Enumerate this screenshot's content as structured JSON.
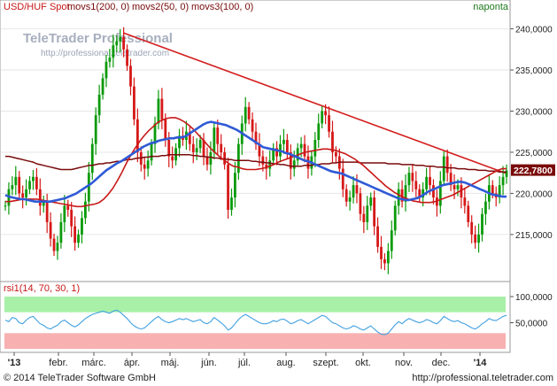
{
  "header": {
    "title": "USD/HUF Spot",
    "indicator_1": "movs1(200, 0)",
    "indicator_2": "movs2(50, 0)",
    "indicator_3": "movs3(100, 0)",
    "period_label": "naponta"
  },
  "watermark": {
    "brand": "TeleTrader Professional",
    "url": "http://professional.teletrader.com"
  },
  "rsi": {
    "label": "rsi1(14, 70, 30, 1)",
    "levels": [
      100,
      70,
      50,
      30,
      0
    ],
    "y_tick_labels": [
      "100,0000",
      "50,0000"
    ]
  },
  "footer": {
    "copyright": "© 2014 TeleTrader Software GmbH",
    "url": "http://professional.teletrader.com"
  },
  "colors": {
    "price_up": "#0a9a0a",
    "price_down": "#d61818",
    "ma200": "#7a0a0a",
    "ma50": "#2f5ad6",
    "ma100": "#c81818",
    "trendline": "#d42020",
    "rsi_line": "#3fa0e0",
    "rsi_overbought_zone": "#a8f0a8",
    "rsi_oversold_zone": "#f8b0b0",
    "last_price_box": "#7a0a0a"
  },
  "chart_data": [
    {
      "type": "line",
      "title": "USD/HUF Spot",
      "x_tick_labels": [
        "'13",
        "febr.",
        "márc.",
        "ápr.",
        "máj.",
        "jún.",
        "júl.",
        "aug.",
        "szept.",
        "okt.",
        "nov.",
        "dec.",
        "'14"
      ],
      "y_tick_labels": [
        "240,0000",
        "235,0000",
        "230,0000",
        "225,0000",
        "220,0000",
        "215,0000"
      ],
      "ylim": [
        209.5,
        242
      ],
      "last_value_label": "222,7800",
      "series": [
        {
          "name": "USD/HUF Spot",
          "style": "ohlc",
          "values": [
            218.5,
            220.5,
            221.0,
            222.0,
            220.0,
            219.5,
            220.5,
            221.5,
            222.0,
            220.5,
            218.5,
            219.0,
            216.5,
            214.5,
            213.0,
            214.0,
            216.5,
            218.5,
            218.0,
            216.0,
            214.0,
            215.0,
            217.0,
            219.0,
            222.5,
            226.0,
            229.5,
            232.0,
            234.0,
            236.0,
            236.5,
            238.0,
            238.5,
            239.0,
            237.5,
            235.5,
            233.0,
            229.0,
            225.0,
            223.5,
            223.0,
            224.0,
            226.0,
            228.5,
            231.5,
            229.0,
            226.5,
            224.5,
            224.0,
            225.5,
            227.0,
            226.5,
            227.5,
            226.0,
            225.0,
            225.5,
            226.5,
            224.5,
            223.5,
            225.0,
            228.0,
            226.0,
            225.0,
            223.5,
            218.0,
            219.5,
            222.5,
            226.0,
            228.5,
            230.5,
            229.0,
            227.5,
            226.0,
            224.5,
            223.5,
            223.0,
            224.0,
            225.5,
            224.5,
            226.0,
            226.5,
            225.0,
            223.0,
            224.0,
            225.5,
            226.0,
            224.5,
            223.0,
            224.5,
            226.5,
            228.5,
            230.0,
            229.5,
            227.5,
            225.0,
            224.5,
            223.0,
            220.5,
            219.0,
            219.5,
            221.0,
            220.0,
            217.5,
            216.5,
            218.5,
            219.5,
            216.0,
            213.5,
            212.0,
            211.5,
            213.0,
            215.5,
            218.5,
            220.5,
            219.0,
            221.0,
            222.5,
            221.5,
            220.5,
            219.5,
            220.5,
            222.0,
            221.0,
            219.5,
            218.5,
            221.5,
            224.5,
            222.5,
            221.0,
            220.5,
            221.0,
            219.5,
            218.5,
            216.5,
            215.0,
            214.0,
            215.0,
            217.5,
            219.0,
            221.0,
            220.0,
            219.5,
            221.0,
            222.0,
            222.78
          ]
        },
        {
          "name": "movs1(200, 0)",
          "values": [
            224.5,
            224.5,
            224.4,
            224.3,
            224.2,
            224.1,
            224.0,
            223.9,
            223.8,
            223.6,
            223.5,
            223.4,
            223.3,
            223.2,
            223.1,
            223.0,
            222.9,
            222.9,
            222.9,
            222.9,
            223.0,
            223.1,
            223.2,
            223.3,
            223.4,
            223.4,
            223.5,
            223.6,
            223.6,
            223.7,
            223.7,
            223.8,
            223.9,
            223.9,
            224.0,
            224.1,
            224.1,
            224.2,
            224.3,
            224.3,
            224.4,
            224.4,
            224.5,
            224.5,
            224.5,
            224.6,
            224.6,
            224.7,
            224.7,
            224.7,
            224.7,
            224.7,
            224.7,
            224.7,
            224.6,
            224.6,
            224.5,
            224.5,
            224.4,
            224.4,
            224.3,
            224.3,
            224.2,
            224.2,
            224.1,
            224.1,
            224.0,
            224.0,
            224.0,
            224.0,
            224.0,
            223.9,
            223.9,
            223.8,
            223.8,
            223.7,
            223.7,
            223.6,
            223.6,
            223.5,
            223.5,
            223.4,
            223.3,
            223.3,
            223.3,
            223.3,
            223.4,
            223.4,
            223.4,
            223.5,
            223.5,
            223.6,
            223.6,
            223.6,
            223.7,
            223.7,
            223.8,
            223.8,
            223.8,
            223.8,
            223.8,
            223.8,
            223.7,
            223.7,
            223.7,
            223.7,
            223.7,
            223.7,
            223.7,
            223.7,
            223.6,
            223.6,
            223.6,
            223.6,
            223.5,
            223.5,
            223.5,
            223.5,
            223.4,
            223.4,
            223.4,
            223.3,
            223.3,
            223.3,
            223.2,
            223.2,
            223.2,
            223.1,
            223.1,
            223.1,
            223.0,
            223.0,
            223.0,
            222.9,
            222.9,
            222.9,
            222.8,
            222.8,
            222.8,
            222.7,
            222.7,
            222.7,
            222.6,
            222.6,
            222.6
          ]
        },
        {
          "name": "movs2(50, 0)",
          "values": [
            219.8,
            219.6,
            219.5,
            219.4,
            219.3,
            219.3,
            219.2,
            219.1,
            219.0,
            219.0,
            219.0,
            219.0,
            219.0,
            219.1,
            219.2,
            219.3,
            219.4,
            219.6,
            219.8,
            220.0,
            220.3,
            220.6,
            220.9,
            221.2,
            221.6,
            222.0,
            222.4,
            222.8,
            223.1,
            223.4,
            223.7,
            223.9,
            224.2,
            224.5,
            224.8,
            225.1,
            225.4,
            225.7,
            225.9,
            226.1,
            226.2,
            226.4,
            226.5,
            226.6,
            226.7,
            226.7,
            226.8,
            226.8,
            226.9,
            227.2,
            227.5,
            227.8,
            228.1,
            228.4,
            228.6,
            228.7,
            228.6,
            228.5,
            228.4,
            228.3,
            228.1,
            227.9,
            227.7,
            227.4,
            227.1,
            226.8,
            226.5,
            226.2,
            225.9,
            225.6,
            225.5,
            225.4,
            225.3,
            225.2,
            225.1,
            224.9,
            224.8,
            224.6,
            224.4,
            224.2,
            224.0,
            223.9,
            223.7,
            223.5,
            223.3,
            223.1,
            222.9,
            222.7,
            222.6,
            222.5,
            222.4,
            222.2,
            222.0,
            221.8,
            221.6,
            221.4,
            221.2,
            221.0,
            220.8,
            220.6,
            220.4,
            220.2,
            220.0,
            219.8,
            219.6,
            219.4,
            219.3,
            219.2,
            219.2,
            219.3,
            219.4,
            219.6,
            219.9,
            220.2,
            220.4,
            220.6,
            220.8,
            221.0,
            221.1,
            221.2,
            221.3,
            221.4,
            221.4,
            221.3,
            221.1,
            220.9,
            220.7,
            220.5,
            220.3,
            220.1,
            219.9,
            219.8,
            219.7,
            219.6,
            219.6
          ]
        },
        {
          "name": "movs3(100, 0)",
          "values": [
            219.0,
            219.0,
            219.1,
            219.2,
            219.3,
            219.3,
            219.3,
            219.3,
            219.2,
            219.1,
            219.0,
            218.9,
            218.8,
            218.7,
            218.6,
            218.5,
            218.4,
            218.4,
            218.5,
            218.6,
            218.7,
            218.9,
            219.3,
            219.9,
            220.6,
            221.5,
            222.5,
            223.6,
            224.6,
            225.5,
            226.3,
            227.0,
            227.6,
            228.1,
            228.6,
            228.9,
            229.1,
            229.2,
            229.2,
            229.0,
            228.7,
            228.3,
            227.8,
            227.2,
            226.6,
            226.0,
            225.4,
            224.9,
            224.4,
            224.0,
            223.6,
            223.3,
            223.2,
            223.0,
            222.9,
            222.9,
            222.9,
            223.0,
            223.1,
            223.3,
            223.5,
            223.8,
            224.0,
            224.2,
            224.4,
            224.6,
            224.8,
            225.0,
            225.1,
            225.2,
            225.3,
            225.4,
            225.4,
            225.3,
            225.2,
            225.0,
            224.8,
            224.5,
            224.2,
            223.8,
            223.4,
            222.9,
            222.4,
            221.9,
            221.4,
            220.9,
            220.5,
            220.1,
            219.8,
            219.5,
            219.3,
            219.1,
            219.0,
            218.9,
            218.9,
            218.9,
            219.0,
            219.2,
            219.4,
            219.6,
            219.8,
            220.1,
            220.4,
            220.7,
            221.0,
            221.3,
            221.6,
            221.9,
            222.2,
            222.5,
            222.8,
            223.0,
            223.0
          ]
        }
      ]
    },
    {
      "type": "line",
      "title": "rsi1(14, 70, 30, 1)",
      "ylim": [
        0,
        100
      ],
      "series": [
        {
          "name": "rsi1(14, 70, 30, 1)",
          "values": [
            55,
            52,
            60,
            58,
            50,
            48,
            55,
            60,
            62,
            55,
            48,
            45,
            40,
            38,
            42,
            45,
            52,
            55,
            50,
            45,
            42,
            46,
            52,
            58,
            62,
            66,
            68,
            70,
            72,
            70,
            68,
            72,
            74,
            70,
            64,
            58,
            50,
            44,
            40,
            38,
            40,
            46,
            52,
            58,
            62,
            56,
            52,
            50,
            52,
            55,
            58,
            56,
            58,
            55,
            52,
            54,
            56,
            50,
            48,
            52,
            60,
            55,
            50,
            44,
            36,
            40,
            48,
            56,
            62,
            66,
            62,
            58,
            54,
            50,
            48,
            48,
            50,
            54,
            52,
            56,
            57,
            53,
            48,
            50,
            54,
            56,
            52,
            48,
            52,
            56,
            60,
            64,
            62,
            56,
            50,
            48,
            44,
            40,
            38,
            40,
            44,
            42,
            38,
            36,
            40,
            44,
            38,
            32,
            28,
            27,
            30,
            38,
            46,
            52,
            48,
            54,
            58,
            55,
            52,
            50,
            52,
            56,
            54,
            50,
            48,
            54,
            62,
            58,
            54,
            52,
            54,
            50,
            48,
            44,
            40,
            38,
            42,
            48,
            52,
            58,
            55,
            54,
            58,
            62,
            64
          ]
        }
      ]
    }
  ]
}
